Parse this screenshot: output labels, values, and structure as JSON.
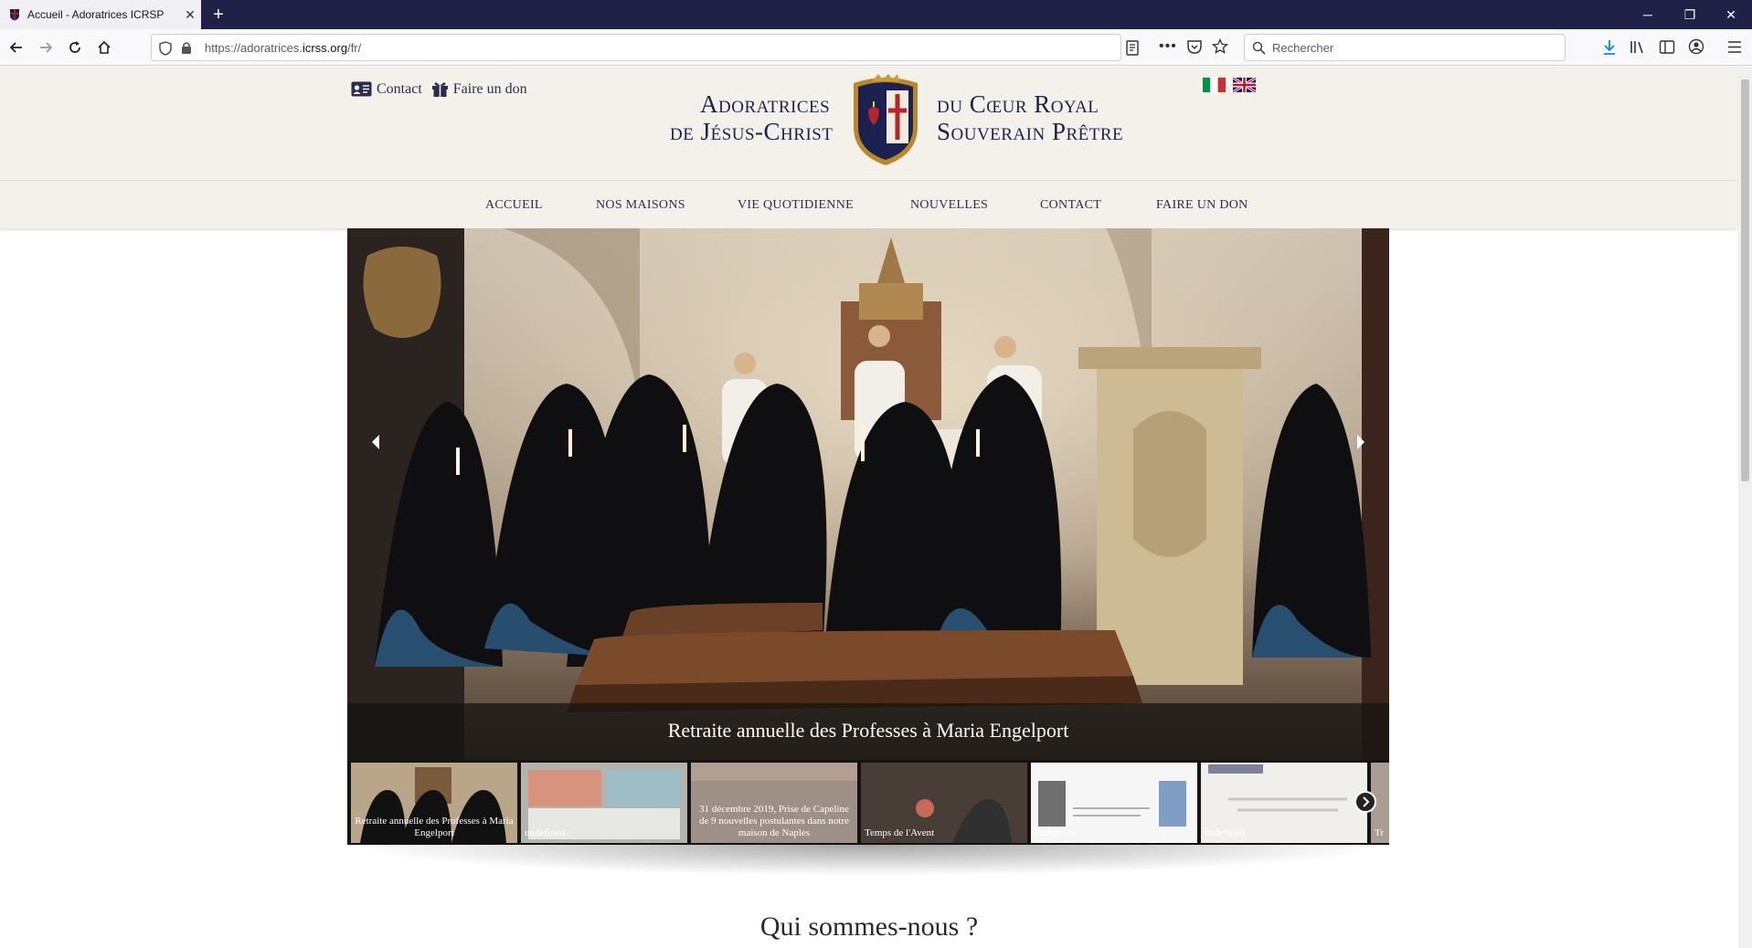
{
  "browser": {
    "tab_title": "Accueil - Adoratrices ICRSP",
    "url_prefix": "https://adoratrices.",
    "url_domain": "icrss.org",
    "url_path": "/fr/",
    "search_placeholder": "Rechercher"
  },
  "header": {
    "contact_label": "Contact",
    "donate_label": "Faire un don",
    "logo_line1_left": "Adoratrices",
    "logo_line2_left": "de Jésus-Christ",
    "logo_line1_right": "du Cœur Royal",
    "logo_line2_right": "Souverain Prêtre"
  },
  "menu": {
    "items": [
      "ACCUEIL",
      "NOS MAISONS",
      "VIE QUOTIDIENNE",
      "NOUVELLES",
      "CONTACT",
      "FAIRE UN DON"
    ]
  },
  "slider": {
    "caption": "Retraite annuelle des Professes à Maria Engelport",
    "thumbs": [
      "Retraite annuelle des Professes à Maria Engelport",
      "undefined",
      "31 décembre 2019, Prise de Capeline de 9 nouvelles postulantes dans notre maison de Naples",
      "Temps de l'Avent",
      "undefined",
      "undefined",
      "Tr"
    ]
  },
  "section": {
    "title": "Qui sommes-nous ?"
  },
  "colors": {
    "header_bg": "#f4f1ea",
    "navy": "#1d2150",
    "browser_top": "#1f2147"
  }
}
